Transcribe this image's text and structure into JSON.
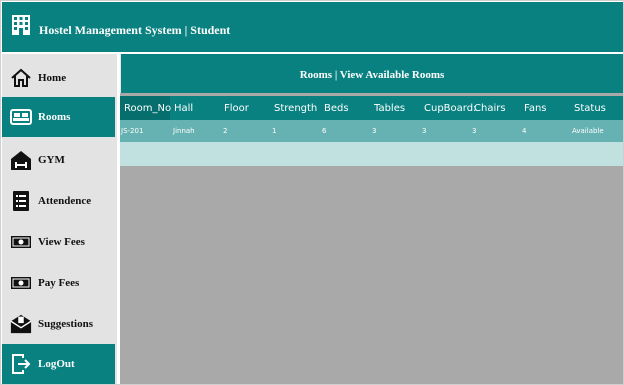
{
  "app": {
    "title": "Hostel Management System | Student",
    "logo_icon": "building-icon"
  },
  "sidebar": {
    "items": [
      {
        "label": "Home",
        "icon": "home-icon",
        "active": false
      },
      {
        "label": "Rooms",
        "icon": "bed-icon",
        "active": true
      },
      {
        "label": "GYM",
        "icon": "gym-icon",
        "active": false
      },
      {
        "label": "Attendence",
        "icon": "clipboard-icon",
        "active": false
      },
      {
        "label": "View Fees",
        "icon": "money-icon",
        "active": false
      },
      {
        "label": "Pay Fees",
        "icon": "money-icon",
        "active": false
      },
      {
        "label": "Suggestions",
        "icon": "envelope-icon",
        "active": false
      },
      {
        "label": "LogOut",
        "icon": "logout-icon",
        "active": true
      }
    ]
  },
  "main": {
    "title": "Rooms | View Available Rooms",
    "table": {
      "columns": [
        "Room_No",
        "Hall",
        "Floor",
        "Strength",
        "Beds",
        "Tables",
        "CupBoard:",
        "Chairs",
        "Fans",
        "Status"
      ],
      "rows": [
        [
          "JS-201",
          "Jinnah",
          "2",
          "1",
          "6",
          "3",
          "3",
          "3",
          "4",
          "Available"
        ]
      ]
    }
  },
  "colors": {
    "primary": "#098180",
    "sidebar_bg": "#e3e3e3",
    "grid_bg": "#a9a9a9",
    "row_bg": "#66b1b1",
    "empty_row_bg": "#c0e1e0"
  }
}
